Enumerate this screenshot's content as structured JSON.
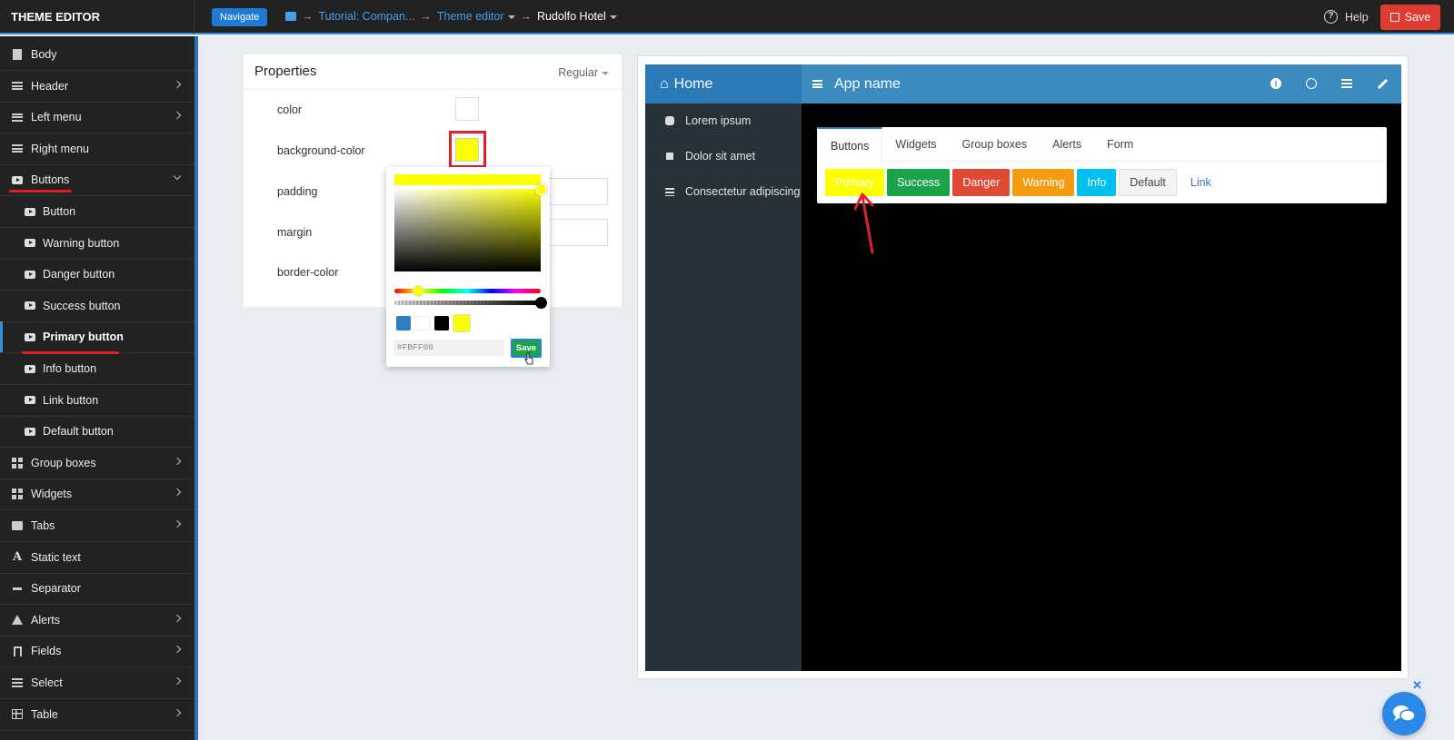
{
  "app": {
    "brand": "THEME EDITOR"
  },
  "topbar": {
    "navigate_label": "Navigate",
    "breadcrumb": [
      {
        "label": "Tutorial: Compan...",
        "type": "link"
      },
      {
        "label": "Theme editor",
        "type": "link",
        "dropdown": true
      },
      {
        "label": "Rudolfo Hotel",
        "type": "current",
        "dropdown": true
      }
    ],
    "help_label": "Help",
    "save_label": "Save"
  },
  "sidebar": {
    "items": [
      {
        "label": "Body",
        "icon": "document-icon",
        "chevron": false
      },
      {
        "label": "Header",
        "icon": "lines-icon",
        "chevron": true
      },
      {
        "label": "Left menu",
        "icon": "align-left-icon",
        "chevron": true
      },
      {
        "label": "Right menu",
        "icon": "align-right-icon",
        "chevron": false
      },
      {
        "label": "Buttons",
        "icon": "youtube-icon",
        "chevron": true,
        "expanded": true
      },
      {
        "label": "Button",
        "icon": "youtube-icon",
        "sub": true
      },
      {
        "label": "Warning button",
        "icon": "youtube-icon",
        "sub": true
      },
      {
        "label": "Danger button",
        "icon": "youtube-icon",
        "sub": true
      },
      {
        "label": "Success button",
        "icon": "youtube-icon",
        "sub": true
      },
      {
        "label": "Primary button",
        "icon": "youtube-icon",
        "sub": true,
        "active": true
      },
      {
        "label": "Info button",
        "icon": "youtube-icon",
        "sub": true
      },
      {
        "label": "Link button",
        "icon": "youtube-icon",
        "sub": true
      },
      {
        "label": "Default button",
        "icon": "youtube-icon",
        "sub": true
      },
      {
        "label": "Group boxes",
        "icon": "grid-icon",
        "chevron": true
      },
      {
        "label": "Widgets",
        "icon": "widgets-icon",
        "chevron": true
      },
      {
        "label": "Tabs",
        "icon": "folder-icon",
        "chevron": true
      },
      {
        "label": "Static text",
        "icon": "font-icon",
        "chevron": false
      },
      {
        "label": "Separator",
        "icon": "minus-icon",
        "chevron": false
      },
      {
        "label": "Alerts",
        "icon": "warning-icon",
        "chevron": true
      },
      {
        "label": "Fields",
        "icon": "flag-icon",
        "chevron": true
      },
      {
        "label": "Select",
        "icon": "list-icon",
        "chevron": true
      },
      {
        "label": "Table",
        "icon": "table-icon",
        "chevron": true
      }
    ]
  },
  "properties": {
    "title": "Properties",
    "mode": "Regular",
    "rows": [
      {
        "label": "color"
      },
      {
        "label": "background-color"
      },
      {
        "label": "padding"
      },
      {
        "label": "margin"
      },
      {
        "label": "border-color"
      }
    ]
  },
  "color_picker": {
    "value": "#FBFF00",
    "save_label": "Save",
    "presets": [
      "#2f7fbf",
      "#ffffff",
      "#000000",
      "#fbff00"
    ]
  },
  "preview": {
    "home_label": "Home",
    "app_name": "App name",
    "side_items": [
      "Lorem ipsum",
      "Dolor sit amet",
      "Consectetur adipiscing"
    ],
    "tabs": [
      "Buttons",
      "Widgets",
      "Group boxes",
      "Alerts",
      "Form"
    ],
    "buttons": [
      {
        "label": "Primary",
        "color": "#fbff00",
        "text": "#ffffff"
      },
      {
        "label": "Success",
        "color": "#1ba34a",
        "text": "#ffffff"
      },
      {
        "label": "Danger",
        "color": "#e04a35",
        "text": "#ffffff"
      },
      {
        "label": "Warning",
        "color": "#f39c12",
        "text": "#ffffff"
      },
      {
        "label": "Info",
        "color": "#00c0ef",
        "text": "#ffffff"
      },
      {
        "label": "Default",
        "color": "#f4f4f4",
        "text": "#444444"
      }
    ],
    "link_label": "Link"
  },
  "colors": {
    "accent": "#3a8ed8",
    "save_red": "#e03b30",
    "annotation_red": "#e0202a"
  }
}
